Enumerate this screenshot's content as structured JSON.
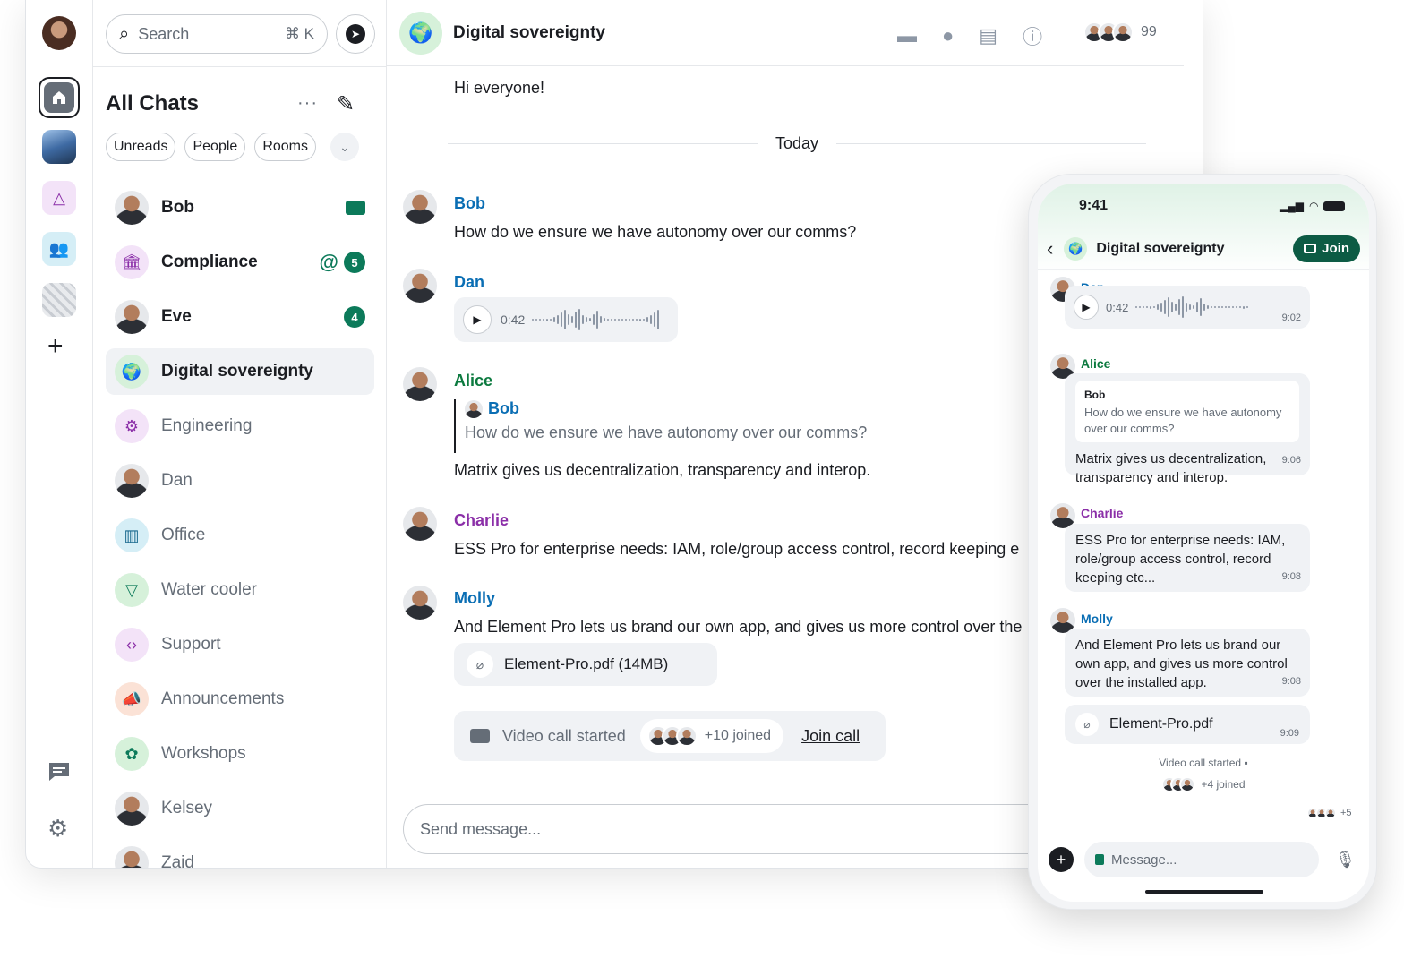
{
  "colors": {
    "accent": "#0c7a5a",
    "join_button": "#0c5b44",
    "text": "#1b1d22",
    "muted": "#656d77"
  },
  "rail": {
    "icons": [
      "home-icon",
      "space-building",
      "shapes-icon",
      "people-icon",
      "map-space",
      "plus-icon",
      "threads-icon",
      "gear-icon"
    ]
  },
  "search": {
    "placeholder": "Search",
    "shortcut": "⌘ K"
  },
  "roomlist": {
    "title": "All Chats",
    "more": "···",
    "filters": [
      "Unreads",
      "People",
      "Rooms"
    ],
    "rooms": [
      {
        "name": "Bob",
        "bold": true,
        "indicator": "envelope"
      },
      {
        "name": "Compliance",
        "bold": true,
        "mention": "@",
        "badge": "5"
      },
      {
        "name": "Eve",
        "bold": true,
        "badge": "4"
      },
      {
        "name": "Digital sovereignty",
        "bold": true,
        "active": true
      },
      {
        "name": "Engineering"
      },
      {
        "name": "Dan"
      },
      {
        "name": "Office"
      },
      {
        "name": "Water cooler"
      },
      {
        "name": "Support"
      },
      {
        "name": "Announcements"
      },
      {
        "name": "Workshops"
      },
      {
        "name": "Kelsey"
      },
      {
        "name": "Zaid"
      }
    ]
  },
  "timeline": {
    "room_name": "Digital sovereignty",
    "member_count": "99",
    "first_message": "Hi everyone!",
    "date_separator": "Today",
    "messages": {
      "bob": {
        "sender": "Bob",
        "body": "How do we ensure we have autonomy over our comms?"
      },
      "dan": {
        "sender": "Dan",
        "duration": "0:42"
      },
      "alice": {
        "sender": "Alice",
        "quote_sender": "Bob",
        "quote_body": "How do we ensure we have autonomy over our comms?",
        "body": "Matrix gives us decentralization, transparency and interop."
      },
      "charlie": {
        "sender": "Charlie",
        "body": "ESS Pro for enterprise needs: IAM, role/group access control, record keeping e"
      },
      "molly": {
        "sender": "Molly",
        "body": "And Element Pro lets us brand our own app, and gives us more control over the",
        "file": "Element-Pro.pdf  (14MB)"
      }
    },
    "call": {
      "text": "Video call started",
      "joined": "+10 joined",
      "join": "Join call"
    },
    "composer_placeholder": "Send message..."
  },
  "phone": {
    "time": "9:41",
    "room_name": "Digital sovereignty",
    "join": "Join",
    "dan": {
      "sender": "Dan",
      "duration": "0:42",
      "time": "9:02"
    },
    "alice": {
      "sender": "Alice",
      "quote_sender": "Bob",
      "quote_body": "How do we ensure we have autonomy over our comms?",
      "body": "Matrix gives us decentralization, transparency and interop.",
      "time": "9:06"
    },
    "charlie": {
      "sender": "Charlie",
      "body": "ESS Pro for enterprise needs: IAM, role/group access control, record keeping etc...",
      "time": "9:08"
    },
    "molly": {
      "sender": "Molly",
      "body": "And Element Pro lets us brand our own app, and gives us more control over the installed app.",
      "time": "9:08"
    },
    "file": {
      "name": "Element-Pro.pdf",
      "time": "9:09"
    },
    "call": {
      "text": "Video call started",
      "joined": "+4 joined",
      "receipts": "+5"
    },
    "composer_placeholder": "Message..."
  }
}
